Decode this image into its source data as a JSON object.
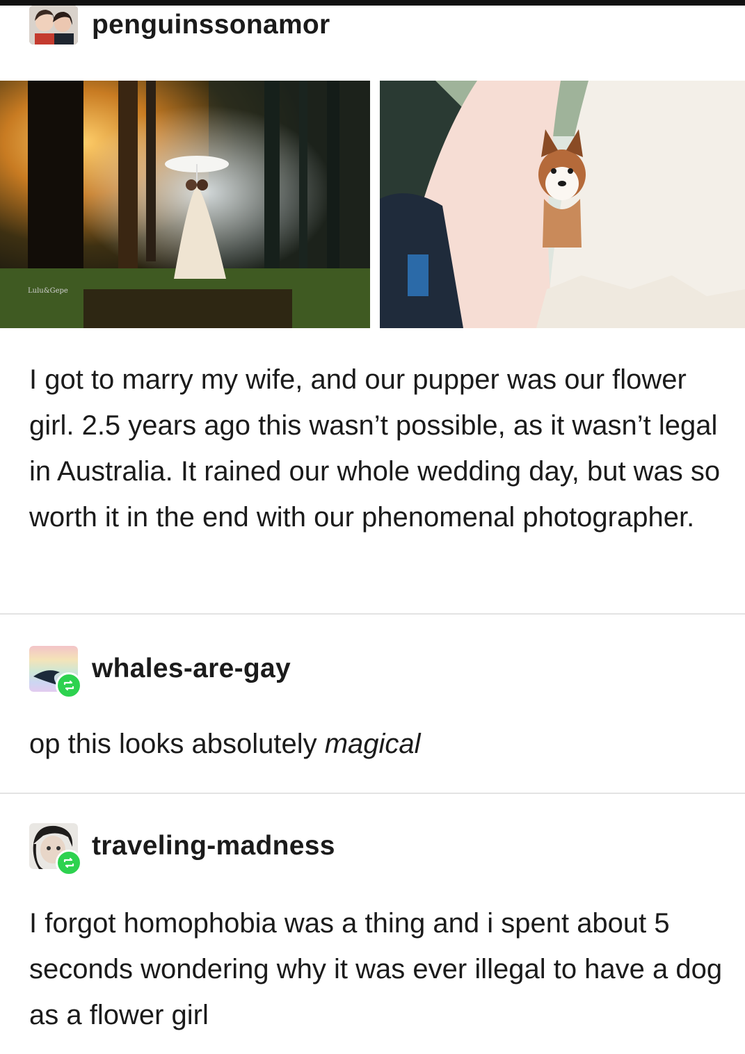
{
  "op": {
    "username": "penguinssonamor",
    "avatar_icon": "couple-avatar-icon",
    "photos": [
      {
        "icon": "forest-wedding-photo",
        "watermark": "Lulu&Gepe"
      },
      {
        "icon": "husky-flower-girl-photo"
      }
    ],
    "text": "I got to marry my wife, and our pupper was our flower girl. 2.5 years ago this wasn’t possible, as it wasn’t legal in Australia. It rained our whole wedding day, but was so worth it in the end with our phenomenal photographer."
  },
  "reblogs": [
    {
      "username": "whales-are-gay",
      "avatar_icon": "rainbow-avatar-icon",
      "badge_icon": "reblog-icon",
      "text_before": "op this looks absolutely ",
      "text_emphasis": "magical"
    },
    {
      "username": "traveling-madness",
      "avatar_icon": "illustrated-character-avatar-icon",
      "badge_icon": "reblog-icon",
      "text": "I forgot homophobia was a thing and i spent about 5 seconds wondering why it was ever illegal to have a dog as a flower girl"
    }
  ],
  "colors": {
    "reblog_badge": "#2dd24f",
    "text": "#1b1b1b",
    "divider": "#e3e3e3"
  }
}
